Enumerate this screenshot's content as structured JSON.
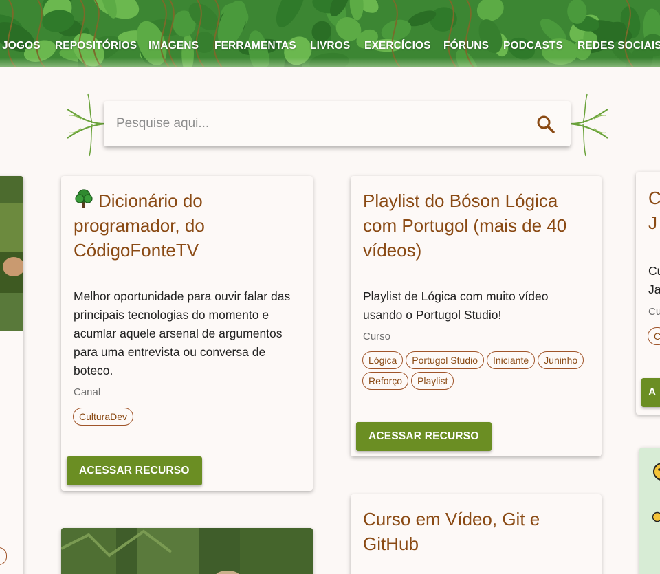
{
  "nav": {
    "items": [
      {
        "label": "JOGOS"
      },
      {
        "label": "REPOSITÓRIOS"
      },
      {
        "label": "IMAGENS"
      },
      {
        "label": "FERRAMENTAS"
      },
      {
        "label": "LIVROS"
      },
      {
        "label": "EXERCÍCIOS"
      },
      {
        "label": "FÓRUNS"
      },
      {
        "label": "PODCASTS"
      },
      {
        "label": "REDES SOCIAIS"
      }
    ]
  },
  "search": {
    "placeholder": "Pesquise aqui...",
    "icon": "search-icon"
  },
  "colors": {
    "header_green": "#3f8a35",
    "title_brown": "#8a4a14",
    "button_green": "#6b8e23",
    "background": "#fcf8f6"
  },
  "cards": [
    {
      "icon": "tree-icon",
      "title": "Dicionário do programador, do CódigoFonteTV",
      "description": "Melhor oportunidade para ouvir falar das principais tecnologias do momento e acumlar aquele arsenal de argumentos para uma entrevista ou conversa de boteco.",
      "type": "Canal",
      "tags": [
        "CulturaDev"
      ],
      "button": "ACESSAR RECURSO"
    },
    {
      "title": "Playlist do Bóson Lógica com Portugol (mais de 40 vídeos)",
      "description": "Playlist de Lógica com muito vídeo usando o Portugol Studio!",
      "type": "Curso",
      "tags": [
        "Lógica",
        "Portugol Studio",
        "Iniciante",
        "Juninho",
        "Reforço",
        "Playlist"
      ],
      "button": "ACESSAR RECURSO"
    },
    {
      "title": "Curso em Vídeo, Git e GitHub"
    },
    {
      "title_partial": "C\nJ",
      "desc_partial": "Cu\nJa",
      "type_partial": "Cu",
      "tag_partial": "C",
      "button_partial": "A"
    }
  ]
}
